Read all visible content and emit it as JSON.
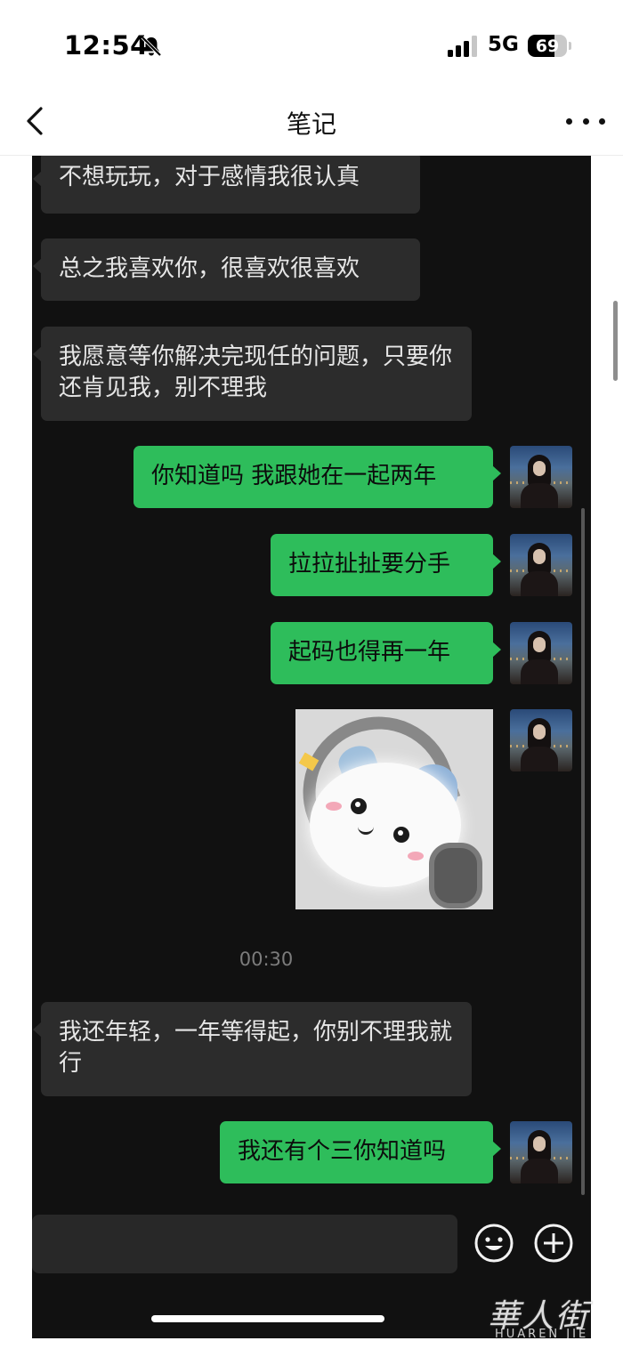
{
  "status_bar": {
    "time": "12:54",
    "network": "5G",
    "battery_percent": "69",
    "battery_level": 0.69,
    "signal_bars_active": 3,
    "signal_bars_total": 4
  },
  "nav": {
    "title": "笔记",
    "back_icon": "chevron-left-icon",
    "more_icon": "ellipsis-icon"
  },
  "chat": {
    "messages": [
      {
        "side": "in",
        "type": "text",
        "text": "不想玩玩，对于感情我很认真"
      },
      {
        "side": "in",
        "type": "text",
        "text": "总之我喜欢你，很喜欢很喜欢"
      },
      {
        "side": "in",
        "type": "text",
        "text": "我愿意等你解决完现任的问题，只要你还肯见我，别不理我"
      },
      {
        "side": "out",
        "type": "text",
        "text": "你知道吗 我跟她在一起两年"
      },
      {
        "side": "out",
        "type": "text",
        "text": "拉拉扯扯要分手"
      },
      {
        "side": "out",
        "type": "text",
        "text": "起码也得再一年"
      },
      {
        "side": "out",
        "type": "image",
        "icon": "hamster-sticker-image"
      },
      {
        "side": "in",
        "type": "text",
        "text": "我还年轻，一年等得起，你别不理我就行"
      },
      {
        "side": "out",
        "type": "text",
        "text": "我还有个三你知道吗"
      }
    ],
    "timestamp": "00:30",
    "input_icons": [
      "emoji-icon",
      "plus-icon"
    ]
  },
  "watermark": {
    "title": "華人街",
    "subtitle": "HUAREN JIE"
  },
  "colors": {
    "incoming_bubble": "#2c2c2c",
    "outgoing_bubble": "#2ebd5b",
    "chat_background": "#111111"
  }
}
